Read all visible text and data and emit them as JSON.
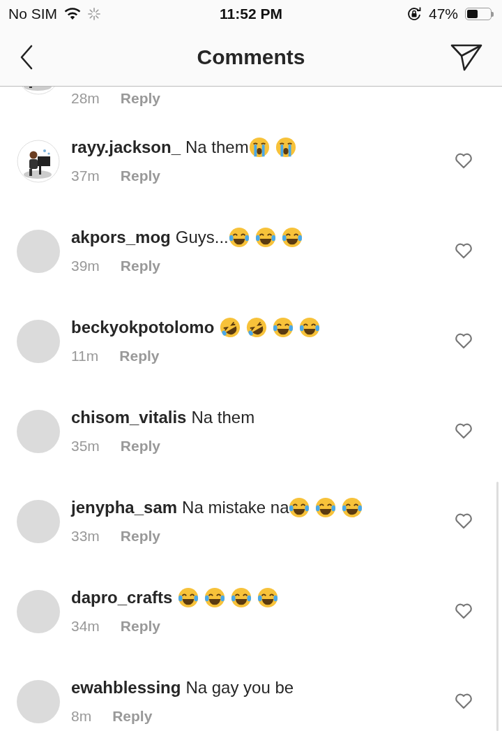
{
  "status_bar": {
    "carrier": "No SIM",
    "time": "11:52 PM",
    "battery": "47%"
  },
  "header": {
    "title": "Comments"
  },
  "comments": [
    {
      "avatar": {
        "kind": "picture"
      },
      "time": "28m",
      "reply": "Reply"
    },
    {
      "avatar": {
        "kind": "picture"
      },
      "user": "rayy.jackson_",
      "text": "Na them",
      "emojis": [
        {
          "kind": "sob"
        },
        {
          "kind": "sob"
        }
      ],
      "time": "37m",
      "reply": "Reply"
    },
    {
      "avatar": {
        "kind": "blank"
      },
      "user": "akpors_mog",
      "text": "Guys...",
      "emojis": [
        {
          "kind": "joy"
        },
        {
          "kind": "joy"
        },
        {
          "kind": "joy"
        }
      ],
      "time": "39m",
      "reply": "Reply"
    },
    {
      "avatar": {
        "kind": "blank"
      },
      "user": "beckyokpotolomo",
      "emojis": [
        {
          "kind": "rofl"
        },
        {
          "kind": "rofl"
        },
        {
          "kind": "joy"
        },
        {
          "kind": "joy"
        }
      ],
      "time": "11m",
      "reply": "Reply"
    },
    {
      "avatar": {
        "kind": "blank"
      },
      "user": "chisom_vitalis",
      "text": "Na them",
      "time": "35m",
      "reply": "Reply"
    },
    {
      "avatar": {
        "kind": "blank"
      },
      "user": "jenypha_sam",
      "text": "Na mistake na",
      "emojis": [
        {
          "kind": "joy"
        },
        {
          "kind": "joy"
        },
        {
          "kind": "joy"
        }
      ],
      "time": "33m",
      "reply": "Reply"
    },
    {
      "avatar": {
        "kind": "blank"
      },
      "user": "dapro_crafts",
      "emojis": [
        {
          "kind": "joy"
        },
        {
          "kind": "joy"
        },
        {
          "kind": "joy"
        },
        {
          "kind": "joy"
        }
      ],
      "time": "34m",
      "reply": "Reply"
    },
    {
      "avatar": {
        "kind": "blank"
      },
      "user": "ewahblessing",
      "text": "Na gay you be",
      "time": "8m",
      "reply": "Reply"
    }
  ]
}
